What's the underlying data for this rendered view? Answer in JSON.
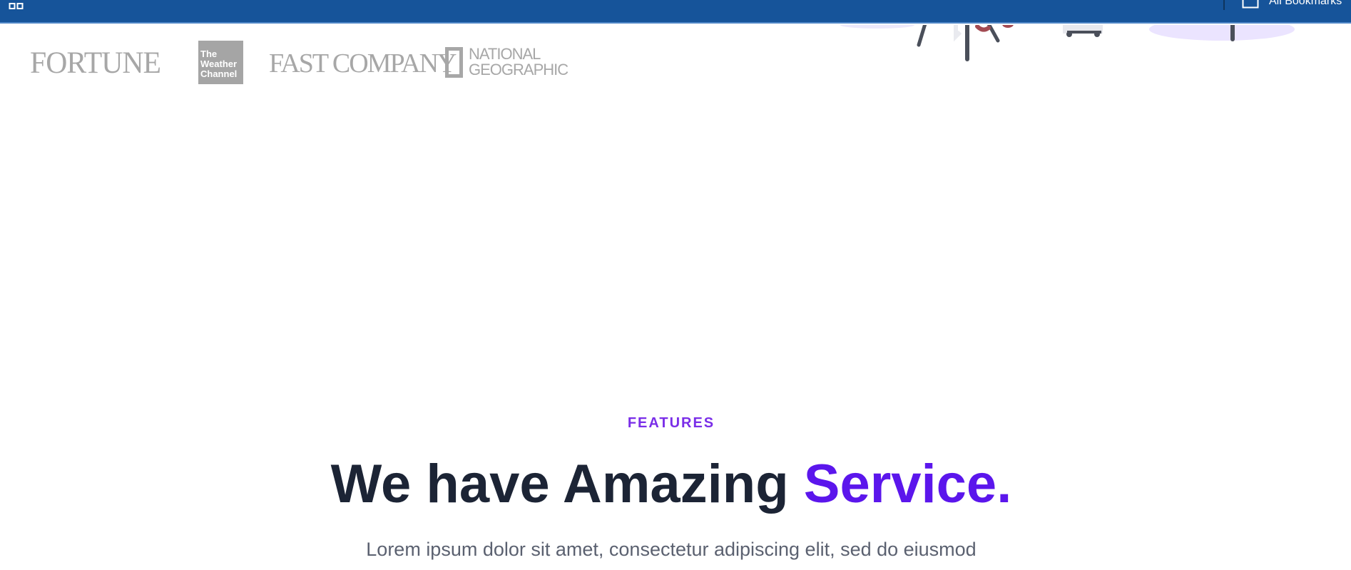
{
  "bookmarks_bar": {
    "apps_icon": "apps-grid-icon",
    "all_bookmarks_label": "All Bookmarks",
    "folder_icon": "folder-icon",
    "background_color": "#16549a"
  },
  "hero": {
    "illustration": "office-illustration"
  },
  "brand_logos": {
    "fortune": "FORTUNE",
    "weather_channel": [
      "The",
      "Weather",
      "Channel"
    ],
    "fast_company": "FAST COMPANY",
    "national_geographic": [
      "NATIONAL",
      "GEOGRAPHIC"
    ],
    "logo_color": "#a7a7a7"
  },
  "features": {
    "eyebrow": "FEATURES",
    "title_main": "We have Amazing ",
    "title_accent": "Service.",
    "description": "Lorem ipsum dolor sit amet, consectetur adipiscing elit, sed do eiusmod",
    "eyebrow_color": "#7a2ee8",
    "title_color": "#1c2435",
    "accent_color": "#5b16ec",
    "description_color": "#5b6170"
  }
}
